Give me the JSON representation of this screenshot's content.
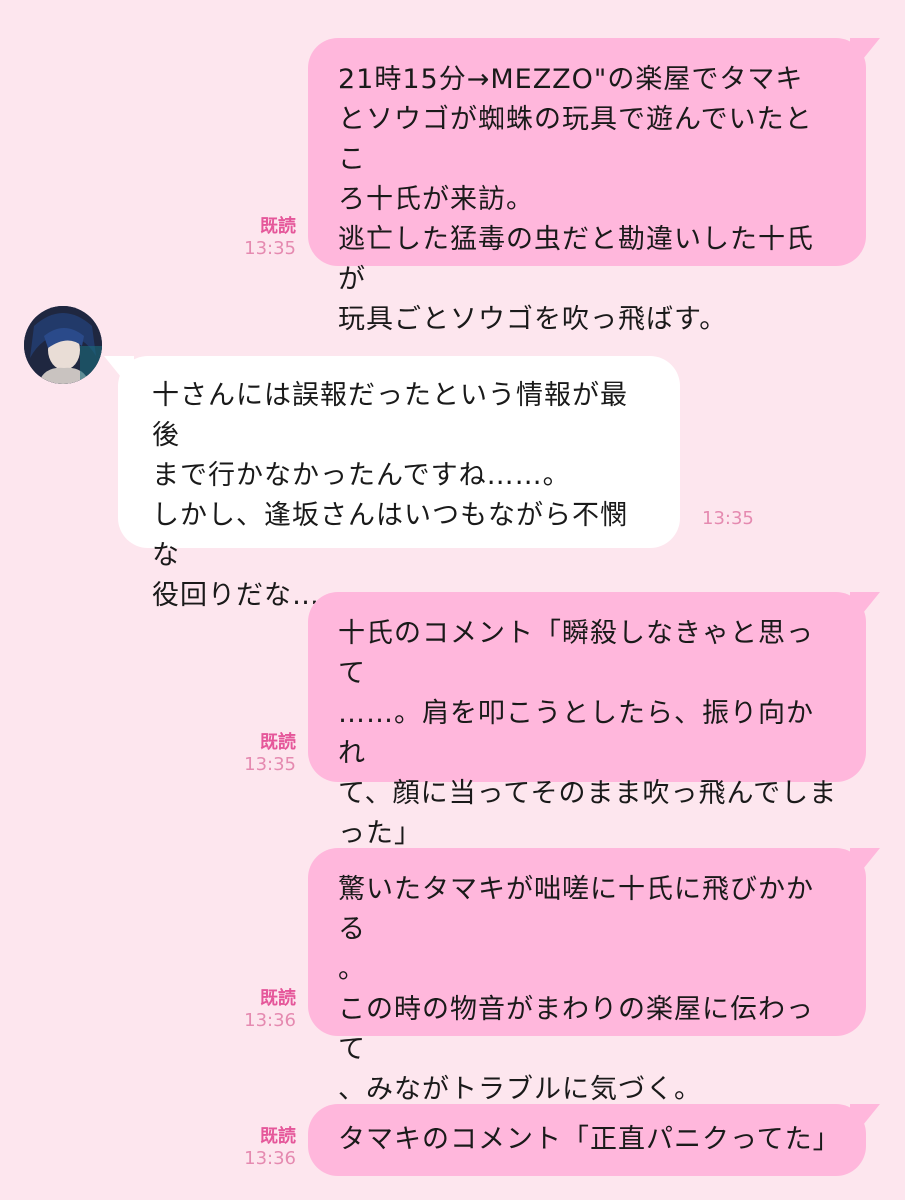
{
  "colors": {
    "background": "#fde6ee",
    "sent_bubble": "#ffb7dc",
    "received_bubble": "#ffffff",
    "read_label": "#e5579a",
    "timestamp": "#e58ab0"
  },
  "messages": [
    {
      "side": "sent",
      "text": "21時15分→MEZZO\"の楽屋でタマキ\nとソウゴが蜘蛛の玩具で遊んでいたとこ\nろ十氏が来訪。\n逃亡した猛毒の虫だと勘違いした十氏が\n玩具ごとソウゴを吹っ飛ばす。",
      "read": "既読",
      "time": "13:35"
    },
    {
      "side": "received",
      "avatar_icon": "character-avatar",
      "text": "十さんには誤報だったという情報が最後\nまで行かなかったんですね……。\nしかし、逢坂さんはいつもながら不憫な\n役回りだな……。",
      "time": "13:35"
    },
    {
      "side": "sent",
      "text": "十氏のコメント「瞬殺しなきゃと思って\n……。肩を叩こうとしたら、振り向かれ\nて、顔に当ってそのまま吹っ飛んでしま\nった」",
      "read": "既読",
      "time": "13:35"
    },
    {
      "side": "sent",
      "text": "驚いたタマキが咄嗟に十氏に飛びかかる\n。\nこの時の物音がまわりの楽屋に伝わって\n、みながトラブルに気づく。",
      "read": "既読",
      "time": "13:36"
    },
    {
      "side": "sent",
      "text": "タマキのコメント「正直パニクってた」",
      "read": "既読",
      "time": "13:36"
    }
  ]
}
